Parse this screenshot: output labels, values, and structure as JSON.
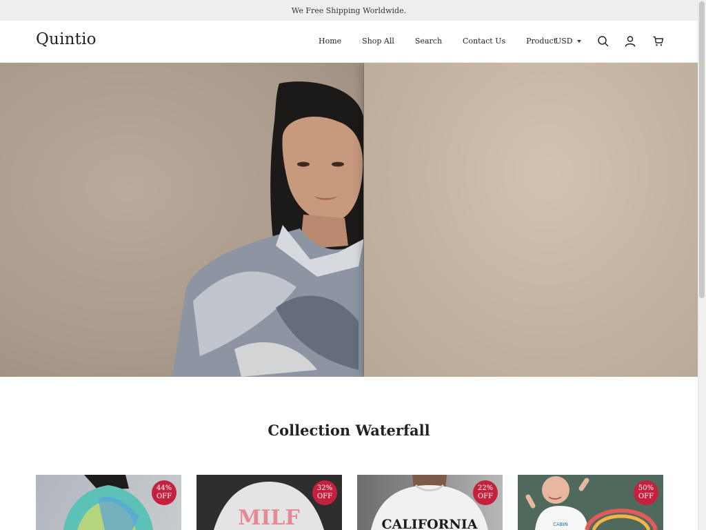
{
  "announcement": "We Free Shipping Worldwide.",
  "brand": "Quintio",
  "nav": {
    "items": [
      "Home",
      "Shop All",
      "Search",
      "Contact Us",
      "Product"
    ]
  },
  "currency": "USD",
  "icons": {
    "search": "search-icon",
    "account": "user-icon",
    "cart": "cart-icon",
    "currency_caret": "caret-down-icon"
  },
  "section": {
    "title": "Collection Waterfall"
  },
  "products": [
    {
      "discount_pct": "44%",
      "discount_word": "OFF"
    },
    {
      "discount_pct": "32%",
      "discount_word": "OFF",
      "print_text": "MILF"
    },
    {
      "discount_pct": "22%",
      "discount_word": "OFF",
      "print_text": "CALIFORNIA"
    },
    {
      "discount_pct": "50%",
      "discount_word": "OFF",
      "print_text": "CABIN"
    }
  ],
  "colors": {
    "badge": "#c4213f",
    "announcement_bg": "#efefef",
    "text": "#222222"
  }
}
